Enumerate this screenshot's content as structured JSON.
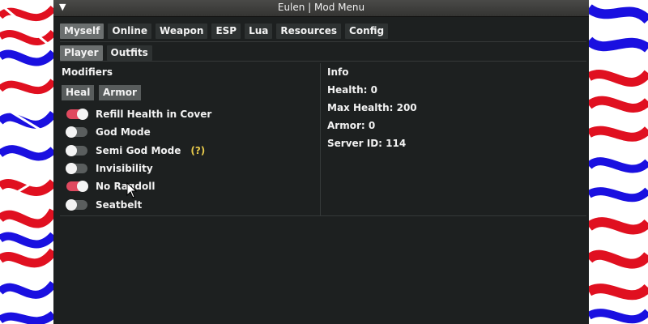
{
  "window": {
    "title": "Eulen | Mod Menu",
    "collapse_glyph": "▼"
  },
  "main_tabs": [
    {
      "label": "Myself",
      "active": true
    },
    {
      "label": "Online",
      "active": false
    },
    {
      "label": "Weapon",
      "active": false
    },
    {
      "label": "ESP",
      "active": false
    },
    {
      "label": "Lua",
      "active": false
    },
    {
      "label": "Resources",
      "active": false
    },
    {
      "label": "Config",
      "active": false
    }
  ],
  "sub_tabs": [
    {
      "label": "Player",
      "active": true
    },
    {
      "label": "Outfits",
      "active": false
    }
  ],
  "modifiers": {
    "heading": "Modifiers",
    "buttons": [
      "Heal",
      "Armor"
    ],
    "toggles": [
      {
        "label": "Refill Health in Cover",
        "on": true
      },
      {
        "label": "God Mode",
        "on": false
      },
      {
        "label": "Semi God Mode",
        "on": false,
        "hint": "(?)"
      },
      {
        "label": "Invisibility",
        "on": false
      },
      {
        "label": "No Ragdoll",
        "on": true
      },
      {
        "label": "Seatbelt",
        "on": false
      }
    ]
  },
  "info": {
    "heading": "Info",
    "lines": [
      "Health: 0",
      "Max Health: 200",
      "Armor: 0",
      "Server ID: 114"
    ]
  },
  "colors": {
    "toggle_on": "#e0495f",
    "toggle_off": "#5a5e5e",
    "panel_bg": "#1d2020",
    "hint": "#e6c84a"
  }
}
